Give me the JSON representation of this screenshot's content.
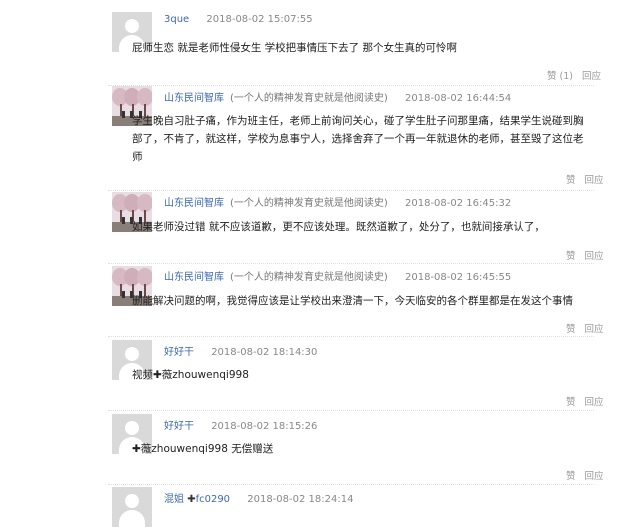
{
  "comments": [
    {
      "user": "3que",
      "note": "",
      "time": "2018-08-02 15:07:55",
      "text": "屁师生恋 就是老师性侵女生 学校把事情压下去了 那个女生真的可怜啊",
      "like": "赞 (1)",
      "reply": "回应"
    },
    {
      "user": "山东民间智库",
      "note": "(一个人的精神发育史就是他阅读史)",
      "time": "2018-08-02 16:44:54",
      "text": "学生晚自习肚子痛，作为班主任，老师上前询问关心，碰了学生肚子问那里痛，结果学生说碰到胸部了，不肯了，就这样，学校为息事宁人，选择舍弃了一个再一年就退休的老师，甚至毁了这位老师",
      "like": "赞",
      "reply": "回应"
    },
    {
      "user": "山东民间智库",
      "note": "(一个人的精神发育史就是他阅读史)",
      "time": "2018-08-02 16:45:32",
      "text": "如果老师没过错 就不应该道歉，更不应该处理。既然道歉了，处分了，也就间接承认了，",
      "like": "赞",
      "reply": "回应"
    },
    {
      "user": "山东民间智库",
      "note": "(一个人的精神发育史就是他阅读史)",
      "time": "2018-08-02 16:45:55",
      "text": "删能解决问题的啊，我觉得应该是让学校出来澄清一下，今天临安的各个群里都是在发这个事情",
      "like": "赞",
      "reply": "回应"
    },
    {
      "user": "好好干",
      "note": "",
      "time": "2018-08-02 18:14:30",
      "text": "视频✚薇zhouwenqi998",
      "like": "赞",
      "reply": "回应"
    },
    {
      "user": "好好干",
      "note": "",
      "time": "2018-08-02 18:15:26",
      "text": "✚薇zhouwenqi998 无偿赠送",
      "like": "赞",
      "reply": "回应"
    },
    {
      "user": "混姐",
      "note": "fc0290",
      "time": "2018-08-02 18:24:14",
      "text": "",
      "like": "",
      "reply": ""
    }
  ],
  "plus_glyph": "✚"
}
